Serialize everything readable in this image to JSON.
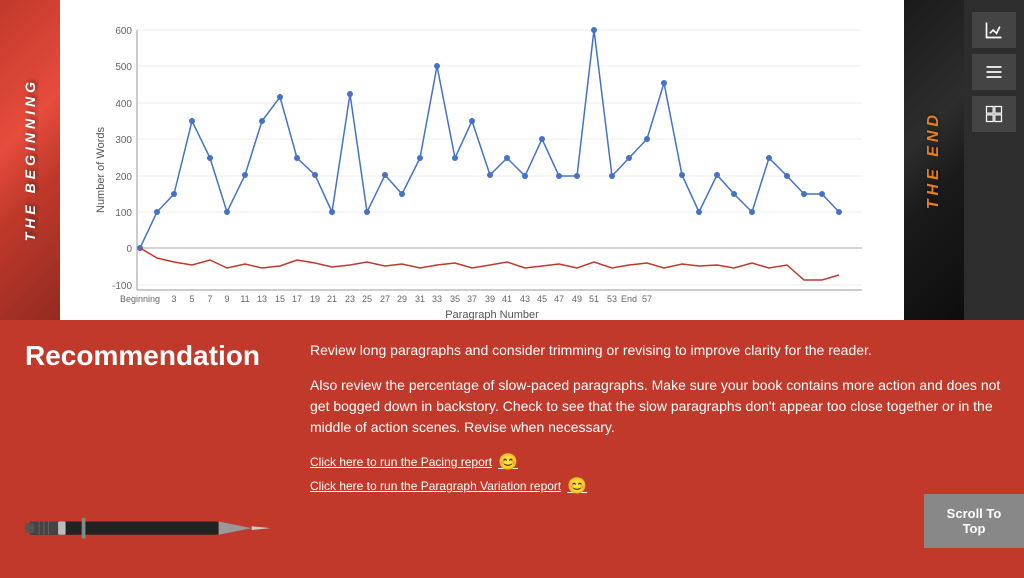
{
  "leftSpine": {
    "text": "THE BEGINNING"
  },
  "rightSpine": {
    "text": "THE END"
  },
  "chart": {
    "title": "Paragraph Number",
    "yAxisLabel": "Number of Words",
    "yMax": 600,
    "yMin": -100,
    "xLabels": [
      "Beginning",
      "3",
      "5",
      "7",
      "9",
      "11",
      "13",
      "15",
      "17",
      "19",
      "21",
      "23",
      "25",
      "27",
      "29",
      "31",
      "33",
      "35",
      "37",
      "39",
      "41",
      "43",
      "45",
      "47",
      "49",
      "51",
      "53",
      "End",
      "57"
    ],
    "yGridLines": [
      600,
      500,
      400,
      300,
      200,
      100,
      0,
      -100
    ]
  },
  "recommendation": {
    "title": "Recommendation",
    "text1": "Review long paragraphs and consider trimming or revising to improve clarity for the reader.",
    "text2": "Also review the percentage of slow-paced paragraphs. Make sure your book contains more action and does not get bogged down in backstory. Check to see that the slow paragraphs don't appear too close together or in the middle of action scenes. Revise when necessary.",
    "link1": "Click here to run the Pacing report",
    "link2": "Click here to run the Paragraph Variation report"
  },
  "scrollToTop": {
    "label": "Scroll To Top"
  },
  "toolbar": {
    "icons": [
      "chart-icon",
      "list-icon",
      "grid-icon"
    ]
  }
}
